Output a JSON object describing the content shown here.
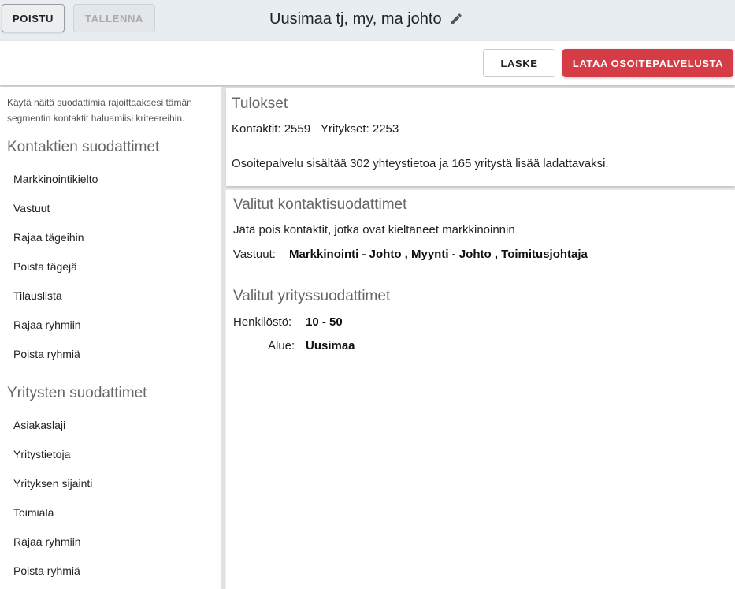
{
  "topbar": {
    "poistu_label": "POISTU",
    "tallenna_label": "TALLENNA",
    "title": "Uusimaa tj, my, ma johto",
    "edit_icon": "pencil-icon"
  },
  "actionbar": {
    "laske_label": "LASKE",
    "lataa_label": "LATAA OSOITEPALVELUSTA",
    "lataa_color": "#d63c45"
  },
  "sidebar": {
    "intro": "Käytä näitä suodattimia rajoittaaksesi tämän segmentin kontaktit haluamiisi kriteereihin.",
    "contact_heading": "Kontaktien suodattimet",
    "contact_items": [
      "Markkinointikielto",
      "Vastuut",
      "Rajaa tägeihin",
      "Poista tägejä",
      "Tilauslista",
      "Rajaa ryhmiin",
      "Poista ryhmiä"
    ],
    "company_heading": "Yritysten suodattimet",
    "company_items": [
      "Asiakaslaji",
      "Yritystietoja",
      "Yrityksen sijainti",
      "Toimiala",
      "Rajaa ryhmiin",
      "Poista ryhmiä"
    ]
  },
  "results": {
    "title": "Tulokset",
    "contacts_label": "Kontaktit:",
    "contacts_value": "2559",
    "companies_label": "Yritykset:",
    "companies_value": "2253",
    "info": "Osoitepalvelu sisältää 302 yhteystietoa ja 165 yritystä lisää ladattavaksi."
  },
  "selected_contact_filters": {
    "heading": "Valitut kontaktisuodattimet",
    "exclude_text": "Jätä pois kontaktit, jotka ovat kieltäneet markkinoinnin",
    "vastuut_label": "Vastuut:",
    "vastuut_value": "Markkinointi - Johto , Myynti - Johto , Toimitusjohtaja"
  },
  "selected_company_filters": {
    "heading": "Valitut yrityssuodattimet",
    "staff_label": "Henkilöstö:",
    "staff_value": "10 - 50",
    "area_label": "Alue:",
    "area_value": "Uusimaa"
  }
}
